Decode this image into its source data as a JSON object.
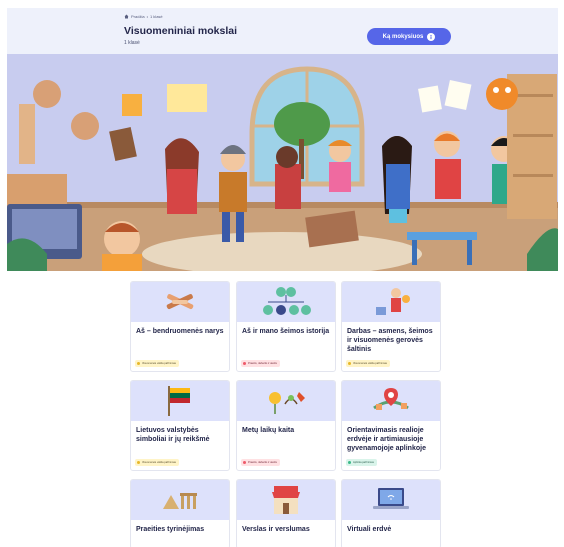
{
  "header": {
    "breadcrumb_home": "Pradžia",
    "breadcrumb_sep": "•",
    "breadcrumb_current": "1 klasė",
    "title": "Visuomeniniai mokslai",
    "subtitle": "1 klasė",
    "learn_button": "Ką mokysiuos"
  },
  "colors": {
    "accent": "#5666e8",
    "card_bg": "#dde1fb"
  },
  "cards": [
    {
      "title": "Aš – bendruomenės narys",
      "tag": "Visuomenės veikla pažinimas",
      "tag_color": "yellow",
      "icon": "hands-circle-icon"
    },
    {
      "title": "Aš ir mano šeimos istorija",
      "tag": "Praeitis, dabartis ir ateitis",
      "tag_color": "pink",
      "icon": "family-tree-icon"
    },
    {
      "title": "Darbas – asmens, šeimos ir visuomenės gerovės šaltinis",
      "tag": "Visuomenės veikla pažinimas",
      "tag_color": "yellow",
      "icon": "worker-icon"
    },
    {
      "title": "Lietuvos valstybės simboliai ir jų reikšmė",
      "tag": "Visuomenės veikla pažinimas",
      "tag_color": "yellow",
      "icon": "flag-icon"
    },
    {
      "title": "Metų laikų kaita",
      "tag": "Praeitis, dabartis ir ateitis",
      "tag_color": "pink",
      "icon": "seasons-icon"
    },
    {
      "title": "Orientavimasis realioje erdvėje ir artimiausioje gyvenamojoje aplinkoje",
      "tag": "Aplinka pažinimas",
      "tag_color": "green",
      "icon": "map-pin-icon"
    },
    {
      "title": "Praeities tyrinėjimas",
      "icon": "ruins-icon"
    },
    {
      "title": "Verslas ir verslumas",
      "icon": "shop-icon"
    },
    {
      "title": "Virtuali erdvė",
      "icon": "laptop-icon"
    }
  ]
}
